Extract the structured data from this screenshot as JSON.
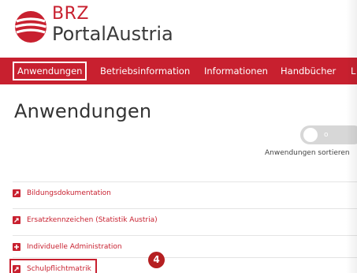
{
  "header": {
    "logo_brz": "BRZ",
    "logo_portal": "PortalAustria",
    "brand_color": "#c8202f"
  },
  "nav": {
    "items": [
      {
        "label": "Anwendungen",
        "active": true
      },
      {
        "label": "Betriebsinformation",
        "active": false
      },
      {
        "label": "Informationen",
        "active": false
      },
      {
        "label": "Handbücher",
        "active": false
      },
      {
        "label": "L",
        "active": false
      }
    ]
  },
  "main": {
    "title": "Anwendungen",
    "toggle_text": "o",
    "sort_label": "Anwendungen sortieren",
    "apps": [
      {
        "label": "Bildungsdokumentation",
        "icon": "external-link-icon"
      },
      {
        "label": "Ersatzkennzeichen (Statistik Austria)",
        "icon": "external-link-icon"
      },
      {
        "label": "Individuelle Administration",
        "icon": "plus-icon"
      },
      {
        "label": "Schulpflichtmatrik",
        "icon": "external-link-icon"
      }
    ]
  },
  "annotation": {
    "step_number": "4"
  }
}
